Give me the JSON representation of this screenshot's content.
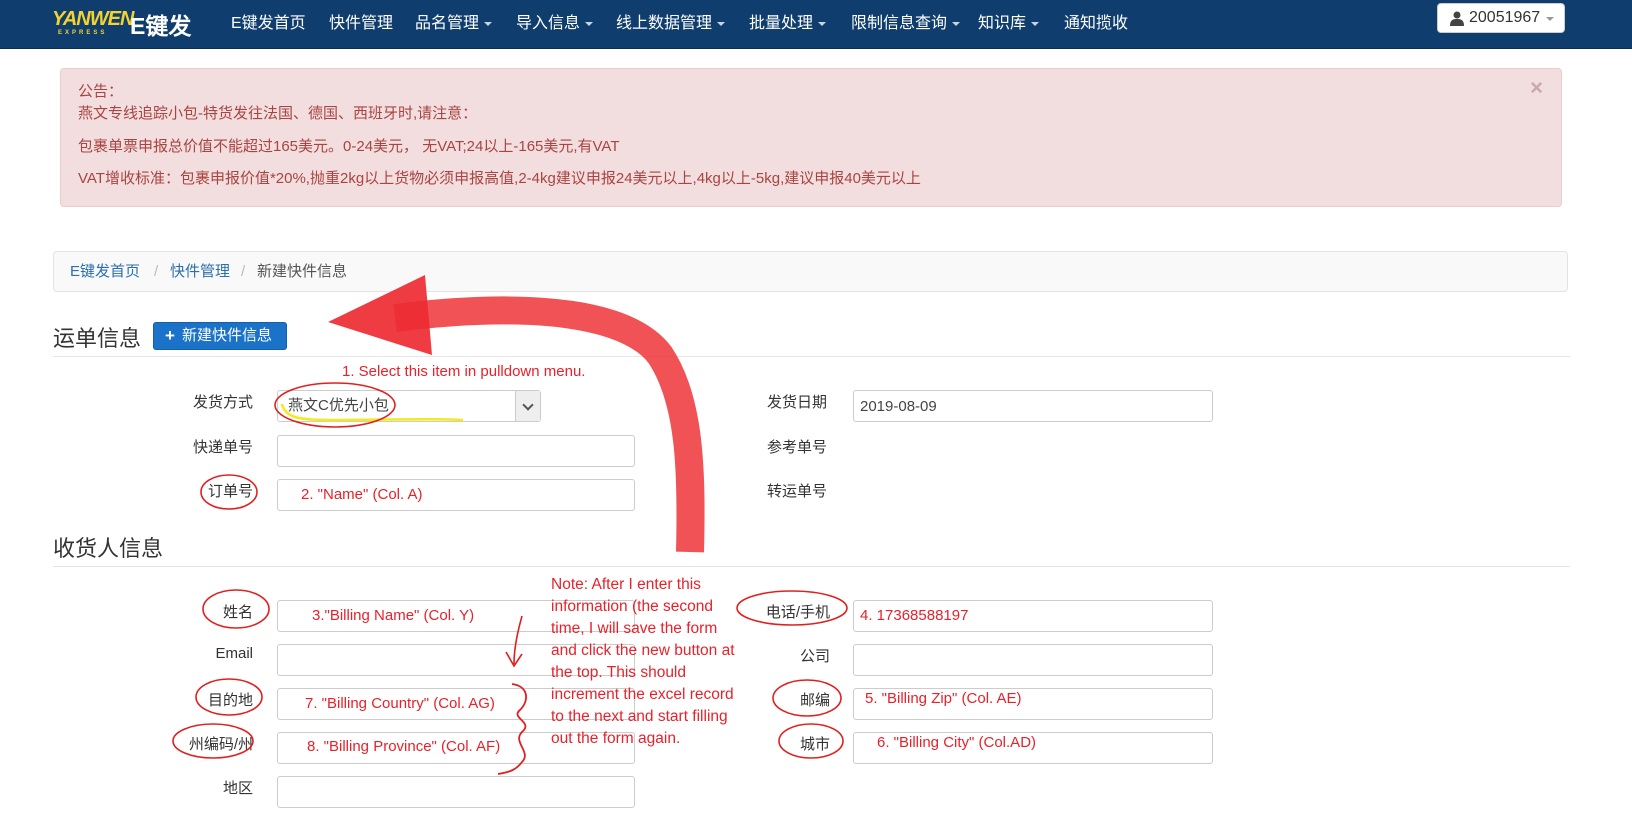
{
  "nav": {
    "logo_text": "YANWEN",
    "logo_sub": "EXPRESS",
    "brand": "E键发",
    "items": [
      {
        "label": "E键发首页",
        "dropdown": false
      },
      {
        "label": "快件管理",
        "dropdown": false
      },
      {
        "label": "品名管理",
        "dropdown": true
      },
      {
        "label": "导入信息",
        "dropdown": true
      },
      {
        "label": "线上数据管理",
        "dropdown": true
      },
      {
        "label": "批量处理",
        "dropdown": true
      },
      {
        "label": "限制信息查询",
        "dropdown": true
      },
      {
        "label": "知识库",
        "dropdown": true
      },
      {
        "label": "通知揽收",
        "dropdown": false
      }
    ],
    "user_id": "20051967"
  },
  "alert": {
    "title": "公告：",
    "lines": [
      "燕文专线追踪小包-特货发往法国、德国、西班牙时,请注意：",
      "包裹单票申报总价值不能超过165美元。0-24美元， 无VAT;24以上-165美元,有VAT",
      "VAT增收标准：包裹申报价值*20%,抛重2kg以上货物必须申报高值,2-4kg建议申报24美元以上,4kg以上-5kg,建议申报40美元以上"
    ],
    "close": "×"
  },
  "breadcrumb": {
    "items": [
      "E键发首页",
      "快件管理",
      "新建快件信息"
    ],
    "separator": "/"
  },
  "waybill": {
    "title": "运单信息",
    "new_button": "新建快件信息",
    "ship_method_label": "发货方式",
    "ship_method_value": "燕文C优先小包",
    "ship_date_label": "发货日期",
    "ship_date_value": "2019-08-09",
    "tracking_label": "快递单号",
    "tracking_value": "",
    "reference_label": "参考单号",
    "order_label": "订单号",
    "order_value": "",
    "transfer_label": "转运单号"
  },
  "consignee": {
    "title": "收货人信息",
    "name_label": "姓名",
    "name_value": "",
    "phone_label": "电话/手机",
    "phone_value": "",
    "email_label": "Email",
    "email_value": "",
    "company_label": "公司",
    "company_value": "",
    "country_label": "目的地",
    "country_value": "",
    "zip_label": "邮编",
    "zip_value": "",
    "province_label": "州编码/州",
    "province_value": "",
    "city_label": "城市",
    "city_value": "",
    "district_label": "地区",
    "district_value": ""
  },
  "annotations": {
    "a1": "1. Select this item in pulldown menu.",
    "a2": "2. \"Name\" (Col. A)",
    "a3": "3.\"Billing Name\" (Col. Y)",
    "a4": "4. 17368588197",
    "a5": "5. \"Billing Zip\" (Col. AE)",
    "a6": "6. \"Billing City\" (Col.AD)",
    "a7": "7. \"Billing Country\" (Col. AG)",
    "a8": "8. \"Billing Province\" (Col. AF)",
    "note": "Note: After I enter this information (the second time, I will save the form and click the new button at the top. This should increment the excel record to the next and start filling out the form again."
  },
  "colors": {
    "nav_bg": "#0f3e6e",
    "alert_bg": "#f2dede",
    "alert_text": "#a94442",
    "primary": "#1a73c9",
    "annotation_red": "#e8212a"
  }
}
